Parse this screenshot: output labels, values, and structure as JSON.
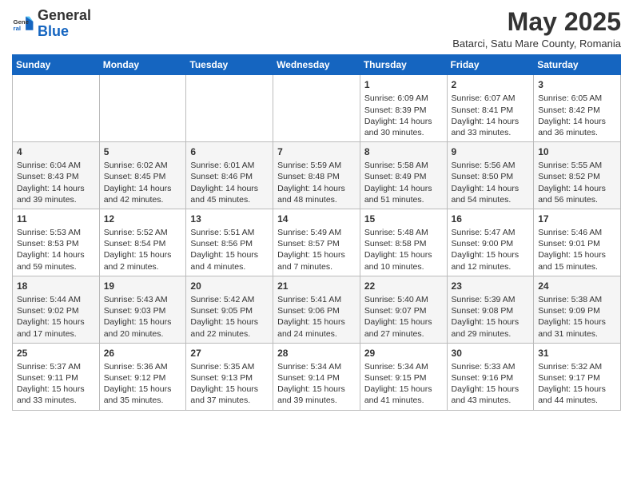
{
  "header": {
    "logo_general": "General",
    "logo_blue": "Blue",
    "month_title": "May 2025",
    "location": "Batarci, Satu Mare County, Romania"
  },
  "days_of_week": [
    "Sunday",
    "Monday",
    "Tuesday",
    "Wednesday",
    "Thursday",
    "Friday",
    "Saturday"
  ],
  "weeks": [
    [
      {
        "day": "",
        "info": ""
      },
      {
        "day": "",
        "info": ""
      },
      {
        "day": "",
        "info": ""
      },
      {
        "day": "",
        "info": ""
      },
      {
        "day": "1",
        "info": "Sunrise: 6:09 AM\nSunset: 8:39 PM\nDaylight: 14 hours\nand 30 minutes."
      },
      {
        "day": "2",
        "info": "Sunrise: 6:07 AM\nSunset: 8:41 PM\nDaylight: 14 hours\nand 33 minutes."
      },
      {
        "day": "3",
        "info": "Sunrise: 6:05 AM\nSunset: 8:42 PM\nDaylight: 14 hours\nand 36 minutes."
      }
    ],
    [
      {
        "day": "4",
        "info": "Sunrise: 6:04 AM\nSunset: 8:43 PM\nDaylight: 14 hours\nand 39 minutes."
      },
      {
        "day": "5",
        "info": "Sunrise: 6:02 AM\nSunset: 8:45 PM\nDaylight: 14 hours\nand 42 minutes."
      },
      {
        "day": "6",
        "info": "Sunrise: 6:01 AM\nSunset: 8:46 PM\nDaylight: 14 hours\nand 45 minutes."
      },
      {
        "day": "7",
        "info": "Sunrise: 5:59 AM\nSunset: 8:48 PM\nDaylight: 14 hours\nand 48 minutes."
      },
      {
        "day": "8",
        "info": "Sunrise: 5:58 AM\nSunset: 8:49 PM\nDaylight: 14 hours\nand 51 minutes."
      },
      {
        "day": "9",
        "info": "Sunrise: 5:56 AM\nSunset: 8:50 PM\nDaylight: 14 hours\nand 54 minutes."
      },
      {
        "day": "10",
        "info": "Sunrise: 5:55 AM\nSunset: 8:52 PM\nDaylight: 14 hours\nand 56 minutes."
      }
    ],
    [
      {
        "day": "11",
        "info": "Sunrise: 5:53 AM\nSunset: 8:53 PM\nDaylight: 14 hours\nand 59 minutes."
      },
      {
        "day": "12",
        "info": "Sunrise: 5:52 AM\nSunset: 8:54 PM\nDaylight: 15 hours\nand 2 minutes."
      },
      {
        "day": "13",
        "info": "Sunrise: 5:51 AM\nSunset: 8:56 PM\nDaylight: 15 hours\nand 4 minutes."
      },
      {
        "day": "14",
        "info": "Sunrise: 5:49 AM\nSunset: 8:57 PM\nDaylight: 15 hours\nand 7 minutes."
      },
      {
        "day": "15",
        "info": "Sunrise: 5:48 AM\nSunset: 8:58 PM\nDaylight: 15 hours\nand 10 minutes."
      },
      {
        "day": "16",
        "info": "Sunrise: 5:47 AM\nSunset: 9:00 PM\nDaylight: 15 hours\nand 12 minutes."
      },
      {
        "day": "17",
        "info": "Sunrise: 5:46 AM\nSunset: 9:01 PM\nDaylight: 15 hours\nand 15 minutes."
      }
    ],
    [
      {
        "day": "18",
        "info": "Sunrise: 5:44 AM\nSunset: 9:02 PM\nDaylight: 15 hours\nand 17 minutes."
      },
      {
        "day": "19",
        "info": "Sunrise: 5:43 AM\nSunset: 9:03 PM\nDaylight: 15 hours\nand 20 minutes."
      },
      {
        "day": "20",
        "info": "Sunrise: 5:42 AM\nSunset: 9:05 PM\nDaylight: 15 hours\nand 22 minutes."
      },
      {
        "day": "21",
        "info": "Sunrise: 5:41 AM\nSunset: 9:06 PM\nDaylight: 15 hours\nand 24 minutes."
      },
      {
        "day": "22",
        "info": "Sunrise: 5:40 AM\nSunset: 9:07 PM\nDaylight: 15 hours\nand 27 minutes."
      },
      {
        "day": "23",
        "info": "Sunrise: 5:39 AM\nSunset: 9:08 PM\nDaylight: 15 hours\nand 29 minutes."
      },
      {
        "day": "24",
        "info": "Sunrise: 5:38 AM\nSunset: 9:09 PM\nDaylight: 15 hours\nand 31 minutes."
      }
    ],
    [
      {
        "day": "25",
        "info": "Sunrise: 5:37 AM\nSunset: 9:11 PM\nDaylight: 15 hours\nand 33 minutes."
      },
      {
        "day": "26",
        "info": "Sunrise: 5:36 AM\nSunset: 9:12 PM\nDaylight: 15 hours\nand 35 minutes."
      },
      {
        "day": "27",
        "info": "Sunrise: 5:35 AM\nSunset: 9:13 PM\nDaylight: 15 hours\nand 37 minutes."
      },
      {
        "day": "28",
        "info": "Sunrise: 5:34 AM\nSunset: 9:14 PM\nDaylight: 15 hours\nand 39 minutes."
      },
      {
        "day": "29",
        "info": "Sunrise: 5:34 AM\nSunset: 9:15 PM\nDaylight: 15 hours\nand 41 minutes."
      },
      {
        "day": "30",
        "info": "Sunrise: 5:33 AM\nSunset: 9:16 PM\nDaylight: 15 hours\nand 43 minutes."
      },
      {
        "day": "31",
        "info": "Sunrise: 5:32 AM\nSunset: 9:17 PM\nDaylight: 15 hours\nand 44 minutes."
      }
    ]
  ]
}
